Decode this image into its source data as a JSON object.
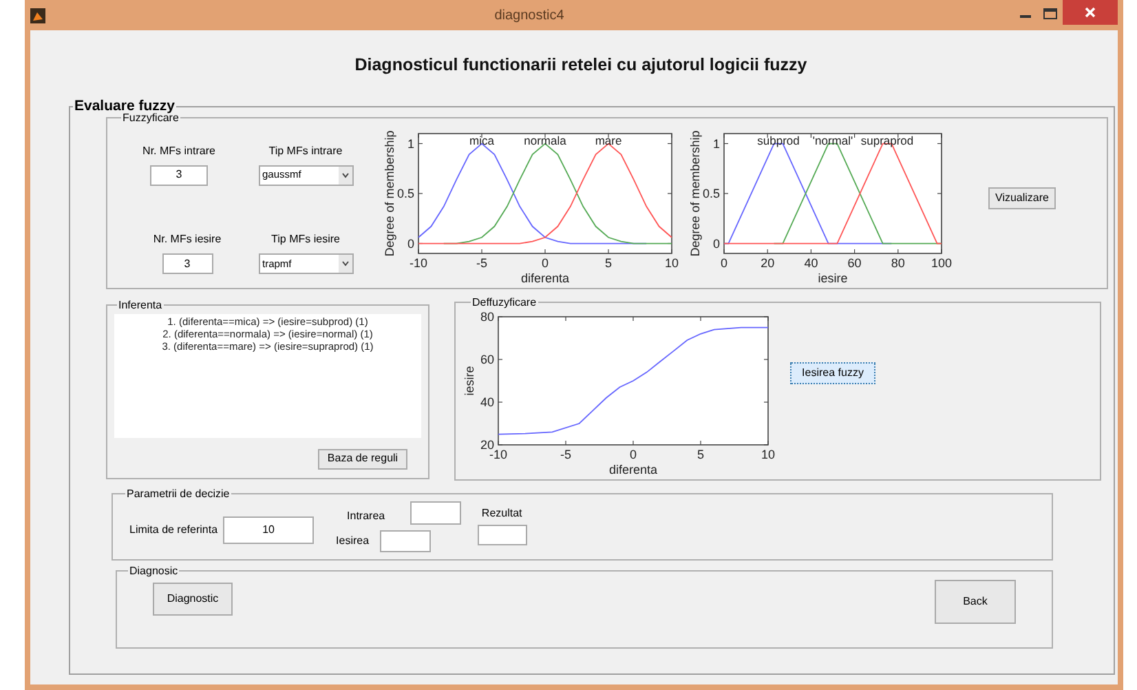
{
  "window": {
    "title": "diagnostic4"
  },
  "heading": "Diagnosticul functionarii retelei cu ajutorul logicii fuzzy",
  "evaluare": {
    "label": "Evaluare fuzzy",
    "fuzzyficare": {
      "label": "Fuzzyficare",
      "inputs": [
        {
          "label": "Nr. MFs intrare",
          "value": "3"
        },
        {
          "label": "Nr. MFs iesire",
          "value": "3"
        }
      ],
      "dropdowns": [
        {
          "label": "Tip MFs intrare",
          "value": "gaussmf"
        },
        {
          "label": "Tip MFs iesire",
          "value": "trapmf"
        }
      ],
      "input_chart": {
        "chart_data": {
          "type": "line",
          "xlabel": "diferenta",
          "ylabel": "Degree of membership",
          "x": [
            -10,
            -9,
            -8,
            -7,
            -6,
            -5,
            -4,
            -3,
            -2,
            -1,
            0,
            1,
            2,
            3,
            4,
            5,
            6,
            7,
            8,
            9,
            10
          ],
          "xlim": [
            -10,
            10
          ],
          "ylim": [
            -0.1,
            1.1
          ],
          "xticks": [
            -10,
            -5,
            0,
            5,
            10
          ],
          "yticks": [
            0,
            0.5,
            1
          ],
          "series": [
            {
              "name": "mica",
              "color": "#6666ff",
              "values": [
                0.06,
                0.17,
                0.37,
                0.64,
                0.89,
                1,
                0.89,
                0.64,
                0.37,
                0.17,
                0.06,
                0.02,
                0,
                0,
                0,
                0,
                0,
                0,
                0,
                null,
                null
              ]
            },
            {
              "name": "normala",
              "color": "#55aa55",
              "values": [
                null,
                null,
                0,
                0,
                0.02,
                0.06,
                0.17,
                0.37,
                0.64,
                0.89,
                1,
                0.89,
                0.64,
                0.37,
                0.17,
                0.06,
                0.02,
                0,
                0,
                0,
                0
              ]
            },
            {
              "name": "mare",
              "color": "#ff5555",
              "values": [
                0,
                0,
                0,
                0,
                0,
                0,
                0,
                0,
                0,
                0.02,
                0.06,
                0.17,
                0.37,
                0.64,
                0.89,
                1,
                0.89,
                0.64,
                0.37,
                0.17,
                0.06
              ]
            }
          ]
        }
      },
      "output_chart": {
        "chart_data": {
          "type": "line",
          "xlabel": "iesire",
          "ylabel": "Degree of membership",
          "x": [
            0,
            2,
            23,
            27,
            48,
            52,
            73,
            77,
            98,
            100
          ],
          "xlim": [
            0,
            100
          ],
          "ylim": [
            -0.1,
            1.1
          ],
          "xticks": [
            0,
            20,
            40,
            60,
            80,
            100
          ],
          "yticks": [
            0,
            0.5,
            1
          ],
          "series": [
            {
              "name": "subprod",
              "color": "#6666ff",
              "values": [
                0,
                0,
                1,
                1,
                0,
                0,
                0,
                0,
                null,
                null
              ]
            },
            {
              "name": "'normal'",
              "color": "#55aa55",
              "values": [
                null,
                null,
                0,
                0,
                1,
                1,
                0,
                0,
                0,
                0
              ]
            },
            {
              "name": "supraprod",
              "color": "#ff5555",
              "values": [
                0,
                0,
                0,
                0,
                0,
                0,
                1,
                1,
                0,
                0
              ]
            }
          ]
        }
      },
      "button": "Vizualizare"
    },
    "inferenta": {
      "label": "Inferenta",
      "rules": [
        "1. (diferenta==mica) => (iesire=subprod) (1)",
        "2. (diferenta==normala) => (iesire=normal) (1)",
        "3. (diferenta==mare) => (iesire=supraprod) (1)"
      ],
      "button": "Baza de reguli"
    },
    "deffuzyficare": {
      "label": "Deffuzyficare",
      "chart_data": {
        "type": "line",
        "xlabel": "diferenta",
        "ylabel": "iesire",
        "x": [
          -10,
          -8,
          -6,
          -4,
          -3,
          -2,
          -1,
          0,
          1,
          2,
          3,
          4,
          5,
          6,
          8,
          10
        ],
        "xlim": [
          -10,
          10
        ],
        "ylim": [
          20,
          80
        ],
        "xticks": [
          -10,
          -5,
          0,
          5,
          10
        ],
        "yticks": [
          20,
          40,
          60,
          80
        ],
        "series": [
          {
            "color": "#6666ff",
            "values": [
              25,
              25.3,
              26,
              30,
              36,
              42,
              47,
              50,
              54,
              59,
              64,
              69,
              72,
              74,
              75,
              75
            ]
          }
        ]
      },
      "button": {
        "label": "Iesirea fuzzy",
        "focused": true
      }
    },
    "parametrii": {
      "label": "Parametrii de decizie",
      "fields": [
        {
          "label": "Limita de referinta",
          "value": "10"
        },
        {
          "label": "Intrarea"
        },
        {
          "label": "Iesirea"
        },
        {
          "label": "Rezultat"
        }
      ]
    },
    "diagnosic": {
      "label": "Diagnosic",
      "buttons": [
        "Diagnostic",
        "Back"
      ]
    }
  }
}
